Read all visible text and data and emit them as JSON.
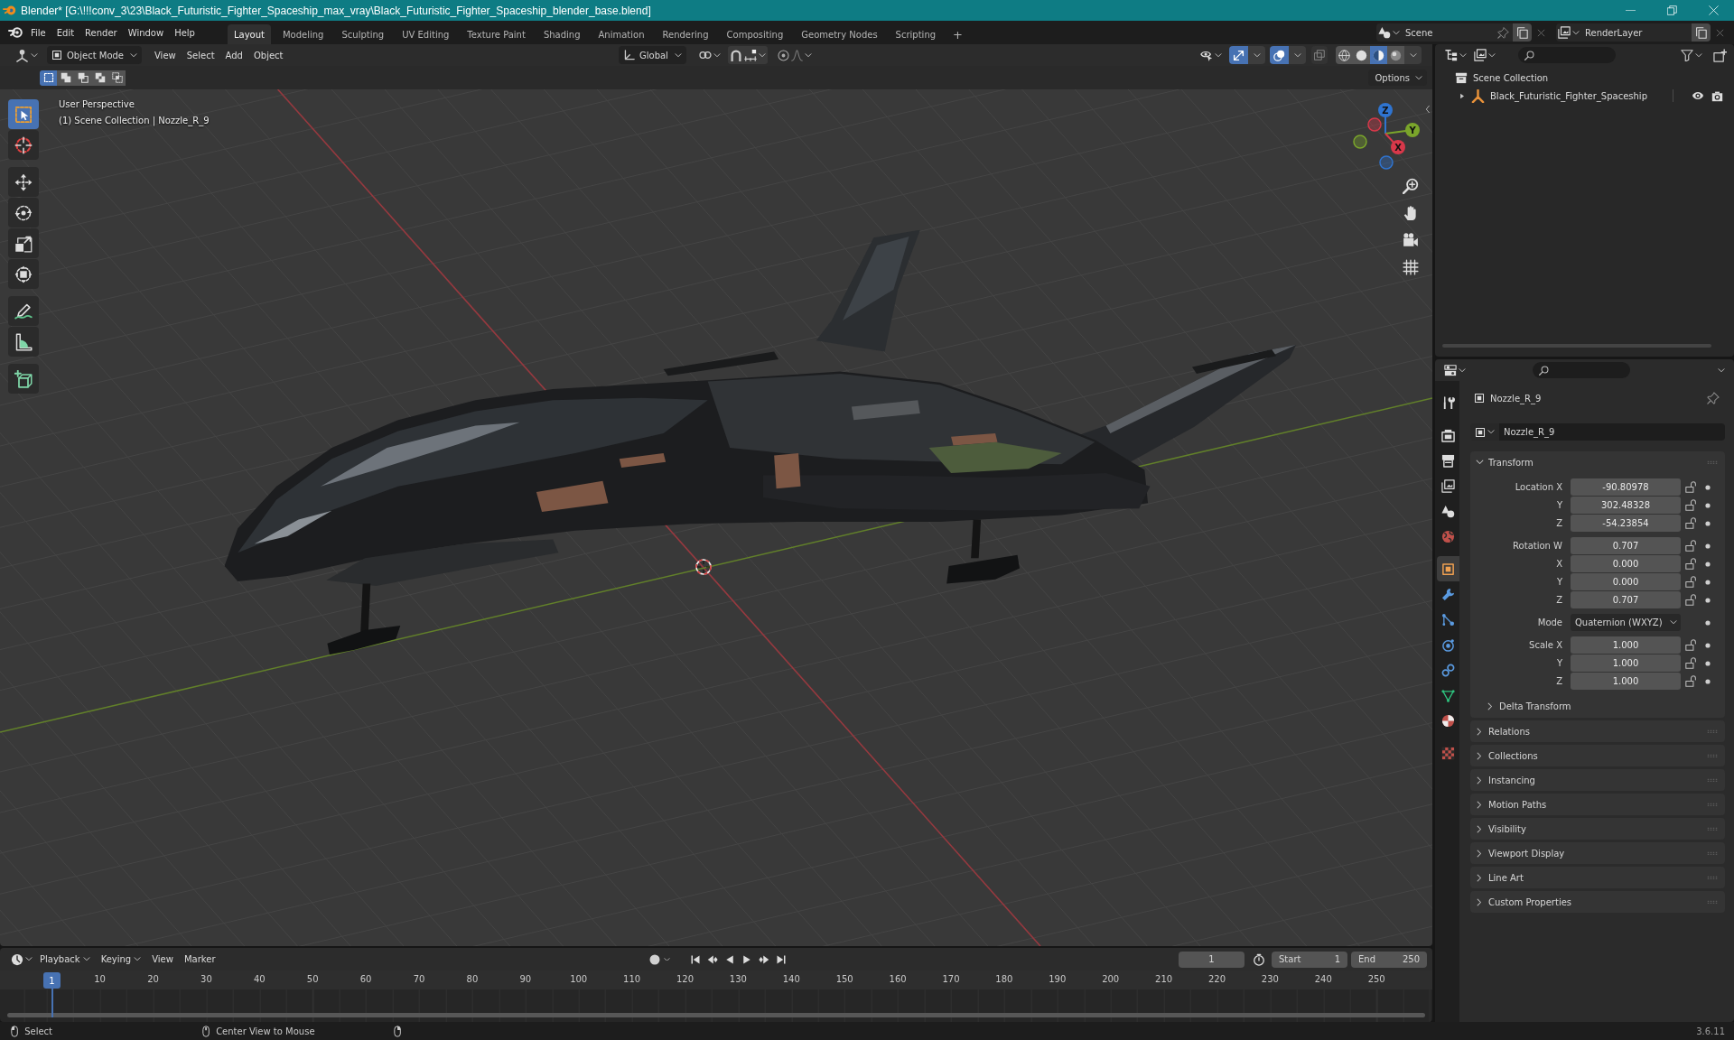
{
  "window": {
    "title": "Blender* [G:\\!!!conv_3\\23\\Black_Futuristic_Fighter_Spaceship_max_vray\\Black_Futuristic_Fighter_Spaceship_blender_base.blend]"
  },
  "top_bar": {
    "menus": [
      "File",
      "Edit",
      "Render",
      "Window",
      "Help"
    ],
    "workspaces": [
      {
        "label": "Layout",
        "selected": true
      },
      {
        "label": "Modeling",
        "selected": false
      },
      {
        "label": "Sculpting",
        "selected": false
      },
      {
        "label": "UV Editing",
        "selected": false
      },
      {
        "label": "Texture Paint",
        "selected": false
      },
      {
        "label": "Shading",
        "selected": false
      },
      {
        "label": "Animation",
        "selected": false
      },
      {
        "label": "Rendering",
        "selected": false
      },
      {
        "label": "Compositing",
        "selected": false
      },
      {
        "label": "Geometry Nodes",
        "selected": false
      },
      {
        "label": "Scripting",
        "selected": false
      }
    ],
    "add_workspace": "+",
    "scene": "Scene",
    "view_layer": "RenderLayer"
  },
  "viewport": {
    "mode": "Object Mode",
    "menus": [
      "View",
      "Select",
      "Add",
      "Object"
    ],
    "orientation": "Global",
    "gizmos": true,
    "overlays": true,
    "xray": false,
    "shading_modes": [
      {
        "kind": "wireframe",
        "selected": false
      },
      {
        "kind": "solid",
        "selected": false
      },
      {
        "kind": "material",
        "selected": true
      },
      {
        "kind": "rendered",
        "selected": false
      }
    ],
    "selection_modes": [
      {
        "kind": "set",
        "selected": true
      },
      {
        "kind": "extend",
        "selected": false
      },
      {
        "kind": "subtract",
        "selected": false
      },
      {
        "kind": "difference",
        "selected": false
      },
      {
        "kind": "intersect",
        "selected": false
      }
    ],
    "options": "Options",
    "view_name": "User Perspective",
    "view_context": "(1) Scene Collection | Nozzle_R_9",
    "tool_groups": [
      [
        {
          "kind": "select_box",
          "selected": true
        },
        {
          "kind": "cursor",
          "selected": false
        }
      ],
      [
        {
          "kind": "move",
          "selected": false
        },
        {
          "kind": "rotate",
          "selected": false
        },
        {
          "kind": "scale",
          "selected": false
        },
        {
          "kind": "transform",
          "selected": false
        }
      ],
      [
        {
          "kind": "annotate",
          "selected": false
        },
        {
          "kind": "measure",
          "selected": false
        }
      ],
      [
        {
          "kind": "add_cube",
          "selected": false
        }
      ]
    ],
    "gizmo_axes": [
      {
        "label": "Z",
        "color": "#2f74d0"
      },
      {
        "label": "Y",
        "color": "#7aa52b"
      },
      {
        "label": "X",
        "color": "#d8384a"
      }
    ]
  },
  "outliner": {
    "root": "Scene Collection",
    "items": [
      {
        "label": "Black_Futuristic_Fighter_Spaceship",
        "expanded": false,
        "visible": true
      }
    ]
  },
  "properties": {
    "tab_groups": [
      [
        {
          "kind": "tool",
          "selected": false
        }
      ],
      [
        {
          "kind": "render",
          "selected": false
        },
        {
          "kind": "output",
          "selected": false
        },
        {
          "kind": "view_layer",
          "selected": false
        },
        {
          "kind": "scene",
          "selected": false
        },
        {
          "kind": "world",
          "selected": false
        }
      ],
      [
        {
          "kind": "object",
          "selected": true
        },
        {
          "kind": "modifiers",
          "selected": false
        },
        {
          "kind": "particles",
          "selected": false
        },
        {
          "kind": "physics",
          "selected": false
        },
        {
          "kind": "constraints",
          "selected": false
        },
        {
          "kind": "data",
          "selected": false
        },
        {
          "kind": "material",
          "selected": false
        }
      ],
      [
        {
          "kind": "texture",
          "selected": false
        }
      ]
    ],
    "object": "Nozzle_R_9",
    "name": "Nozzle_R_9",
    "panels": [
      {
        "title": "Transform",
        "expanded": true,
        "groups": [
          [
            {
              "kind": "number",
              "label": "Location X",
              "value": "-90.80978",
              "locked": false
            },
            {
              "kind": "number",
              "label": "Y",
              "value": "302.48328",
              "locked": false
            },
            {
              "kind": "number",
              "label": "Z",
              "value": "-54.23854",
              "locked": false
            }
          ],
          [
            {
              "kind": "number",
              "label": "Rotation W",
              "value": "0.707",
              "locked": false
            },
            {
              "kind": "number",
              "label": "X",
              "value": "0.000",
              "locked": false
            },
            {
              "kind": "number",
              "label": "Y",
              "value": "0.000",
              "locked": false
            },
            {
              "kind": "number",
              "label": "Z",
              "value": "0.707",
              "locked": false
            }
          ],
          [
            {
              "kind": "dropdown",
              "label": "Mode",
              "value": "Quaternion (WXYZ)"
            }
          ],
          [
            {
              "kind": "number",
              "label": "Scale X",
              "value": "1.000",
              "locked": false
            },
            {
              "kind": "number",
              "label": "Y",
              "value": "1.000",
              "locked": false
            },
            {
              "kind": "number",
              "label": "Z",
              "value": "1.000",
              "locked": false
            }
          ]
        ],
        "subpanels": [
          {
            "title": "Delta Transform",
            "expanded": false
          }
        ]
      },
      {
        "title": "Relations",
        "expanded": false
      },
      {
        "title": "Collections",
        "expanded": false
      },
      {
        "title": "Instancing",
        "expanded": false
      },
      {
        "title": "Motion Paths",
        "expanded": false
      },
      {
        "title": "Visibility",
        "expanded": false
      },
      {
        "title": "Viewport Display",
        "expanded": false
      },
      {
        "title": "Line Art",
        "expanded": false
      },
      {
        "title": "Custom Properties",
        "expanded": false
      }
    ]
  },
  "timeline": {
    "menus": [
      {
        "label": "Playback",
        "kind": "dropdown"
      },
      {
        "label": "Keying",
        "kind": "dropdown"
      },
      {
        "label": "View",
        "kind": "menu"
      },
      {
        "label": "Marker",
        "kind": "menu"
      }
    ],
    "auto_keying": false,
    "current_frame": "1",
    "start_label": "Start",
    "start": "1",
    "end_label": "End",
    "end": "250",
    "playhead": "1",
    "ticks": [
      "10",
      "20",
      "30",
      "40",
      "50",
      "60",
      "70",
      "80",
      "90",
      "100",
      "110",
      "120",
      "130",
      "140",
      "150",
      "160",
      "170",
      "180",
      "190",
      "200",
      "210",
      "220",
      "230",
      "240",
      "250"
    ]
  },
  "status_bar": {
    "hints": [
      "Select",
      "Center View to Mouse"
    ],
    "version": "3.6.11"
  }
}
